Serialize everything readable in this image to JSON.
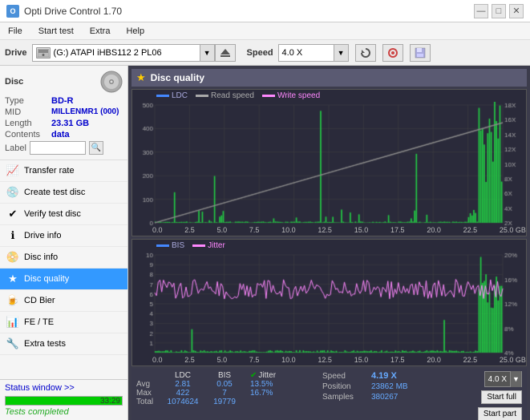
{
  "titlebar": {
    "title": "Opti Drive Control 1.70",
    "icon": "O",
    "minimize": "—",
    "maximize": "□",
    "close": "✕"
  },
  "menubar": {
    "items": [
      "File",
      "Start test",
      "Extra",
      "Help"
    ]
  },
  "drivebar": {
    "label": "Drive",
    "drive_text": "(G:) ATAPI iHBS112  2 PL06",
    "speed_label": "Speed",
    "speed_value": "4.0 X"
  },
  "disc": {
    "title": "Disc",
    "type_label": "Type",
    "type_value": "BD-R",
    "mid_label": "MID",
    "mid_value": "MILLENMR1 (000)",
    "length_label": "Length",
    "length_value": "23.31 GB",
    "contents_label": "Contents",
    "contents_value": "data",
    "label_label": "Label"
  },
  "nav": {
    "items": [
      {
        "id": "transfer-rate",
        "label": "Transfer rate",
        "icon": "📈"
      },
      {
        "id": "create-test-disc",
        "label": "Create test disc",
        "icon": "💿"
      },
      {
        "id": "verify-test-disc",
        "label": "Verify test disc",
        "icon": "✔"
      },
      {
        "id": "drive-info",
        "label": "Drive info",
        "icon": "ℹ"
      },
      {
        "id": "disc-info",
        "label": "Disc info",
        "icon": "📀"
      },
      {
        "id": "disc-quality",
        "label": "Disc quality",
        "icon": "★",
        "active": true
      },
      {
        "id": "cd-bier",
        "label": "CD Bier",
        "icon": "🍺"
      },
      {
        "id": "fe-te",
        "label": "FE / TE",
        "icon": "📊"
      },
      {
        "id": "extra-tests",
        "label": "Extra tests",
        "icon": "🔧"
      }
    ]
  },
  "status": {
    "window_btn": "Status window >>",
    "completed_text": "Tests completed",
    "progress": 100,
    "progress_text": "33:29"
  },
  "chart": {
    "panel_title": "Disc quality",
    "top": {
      "legend": [
        {
          "label": "LDC",
          "color": "#4444ff"
        },
        {
          "label": "Read speed",
          "color": "#888888"
        },
        {
          "label": "Write speed",
          "color": "#ff44ff"
        }
      ],
      "y_left": [
        "500",
        "400",
        "300",
        "200",
        "100",
        "0"
      ],
      "y_right": [
        "18X",
        "16X",
        "14X",
        "12X",
        "10X",
        "8X",
        "6X",
        "4X",
        "2X"
      ],
      "x_labels": [
        "0.0",
        "2.5",
        "5.0",
        "7.5",
        "10.0",
        "12.5",
        "15.0",
        "17.5",
        "20.0",
        "22.5",
        "25.0 GB"
      ]
    },
    "bottom": {
      "legend": [
        {
          "label": "BIS",
          "color": "#4444ff"
        },
        {
          "label": "Jitter",
          "color": "#ff44ff"
        }
      ],
      "y_left": [
        "10",
        "9",
        "8",
        "7",
        "6",
        "5",
        "4",
        "3",
        "2",
        "1"
      ],
      "y_right": [
        "20%",
        "16%",
        "12%",
        "8%",
        "4%"
      ],
      "x_labels": [
        "0.0",
        "2.5",
        "5.0",
        "7.5",
        "10.0",
        "12.5",
        "15.0",
        "17.5",
        "20.0",
        "22.5",
        "25.0 GB"
      ]
    }
  },
  "stats": {
    "ldc_header": "LDC",
    "bis_header": "BIS",
    "jitter_header": "Jitter",
    "avg_label": "Avg",
    "max_label": "Max",
    "total_label": "Total",
    "ldc_avg": "2.81",
    "ldc_max": "422",
    "ldc_total": "1074624",
    "bis_avg": "0.05",
    "bis_max": "7",
    "bis_total": "19779",
    "jitter_avg": "13.5%",
    "jitter_max": "16.7%",
    "jitter_label_check": "✔ Jitter",
    "speed_label": "Speed",
    "speed_value": "4.19 X",
    "speed_select": "4.0 X",
    "position_label": "Position",
    "position_value": "23862 MB",
    "samples_label": "Samples",
    "samples_value": "380267",
    "start_full_label": "Start full",
    "start_part_label": "Start part"
  }
}
